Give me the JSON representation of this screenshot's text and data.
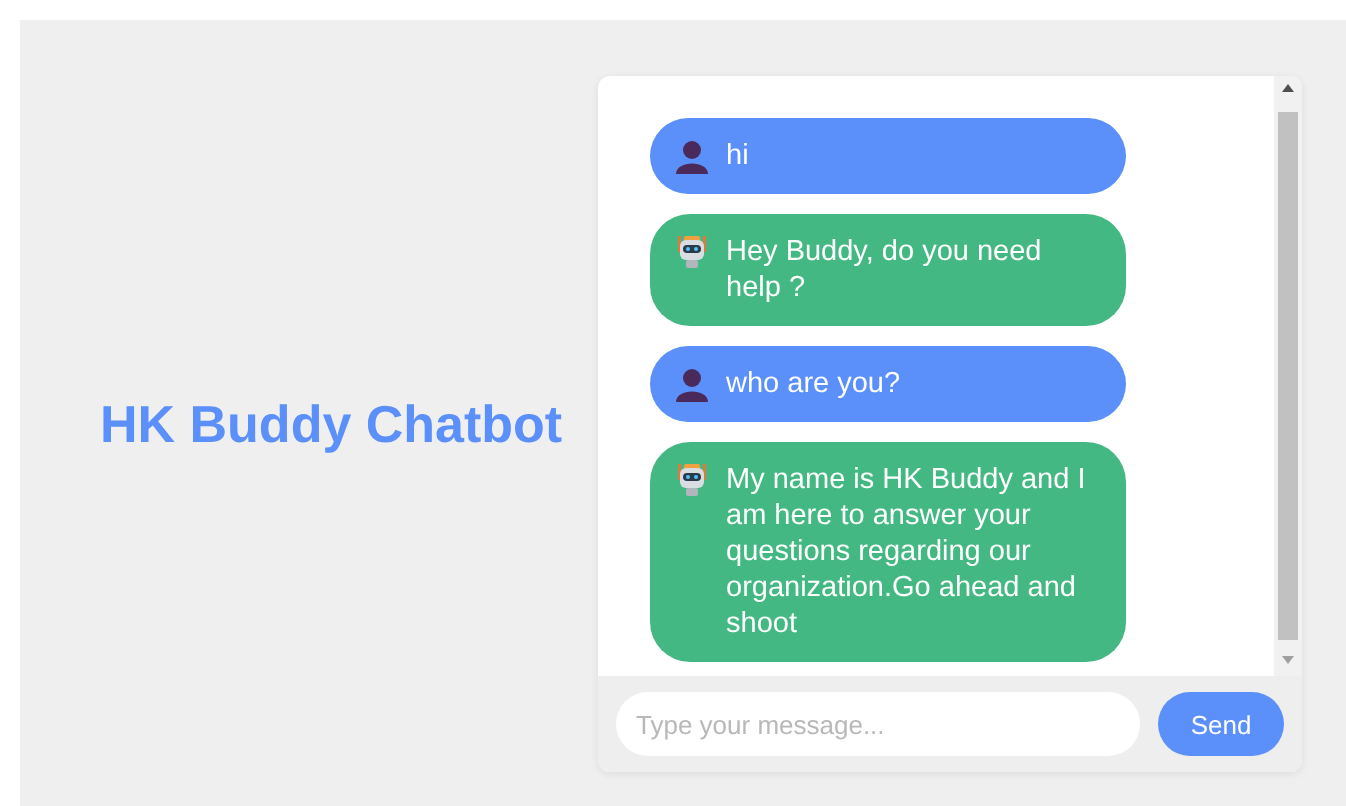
{
  "title": "HK Buddy Chatbot",
  "messages": [
    {
      "kind": "user",
      "text": "hi"
    },
    {
      "kind": "bot",
      "text": "Hey Buddy, do you need help ?"
    },
    {
      "kind": "user",
      "text": "who are you?"
    },
    {
      "kind": "bot",
      "text": "My name is HK Buddy and I am here to answer your questions regarding our organization.Go ahead and shoot"
    }
  ],
  "input": {
    "placeholder": "Type your message..."
  },
  "send_button": "Send"
}
